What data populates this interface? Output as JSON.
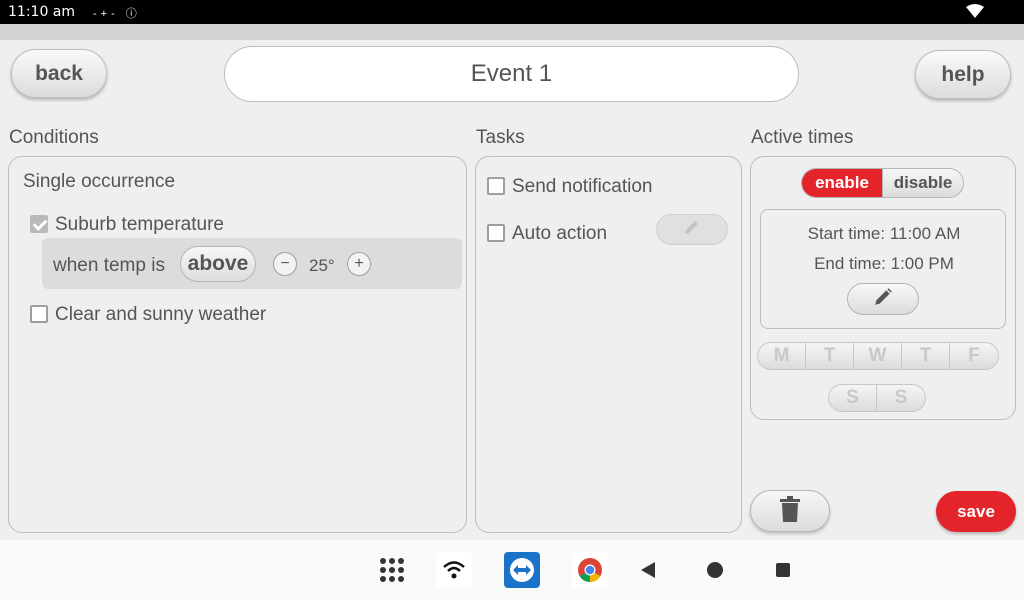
{
  "status_bar": {
    "time": "11:10 am",
    "indicators": "-+- ⓘ"
  },
  "header": {
    "back_label": "back",
    "title": "Event 1",
    "help_label": "help"
  },
  "conditions": {
    "heading": "Conditions",
    "occurrence": "Single occurrence",
    "items": [
      {
        "label": "Suburb temperature",
        "checked": true
      },
      {
        "label": "Clear and sunny weather",
        "checked": false
      }
    ],
    "temp_rule": {
      "prefix": "when temp is",
      "comparison": "above",
      "minus": "−",
      "value": "25°",
      "plus": "+"
    }
  },
  "tasks": {
    "heading": "Tasks",
    "items": [
      {
        "label": "Send notification",
        "checked": false
      },
      {
        "label": "Auto action",
        "checked": false
      }
    ]
  },
  "active_times": {
    "heading": "Active times",
    "enable_label": "enable",
    "disable_label": "disable",
    "start_time": "Start time: 11:00 AM",
    "end_time": "End time: 1:00 PM",
    "weekdays": [
      "M",
      "T",
      "W",
      "T",
      "F"
    ],
    "weekend": [
      "S",
      "S"
    ]
  },
  "actions": {
    "save_label": "save"
  },
  "colors": {
    "accent_red": "#e3242b",
    "panel_border": "#bdbdbd",
    "background": "#efefef"
  },
  "nav_bar": {
    "icons": [
      "apps-grid-icon",
      "wifi-icon",
      "teamviewer-icon",
      "chrome-icon",
      "back-triangle-icon",
      "home-circle-icon",
      "recents-square-icon"
    ]
  }
}
